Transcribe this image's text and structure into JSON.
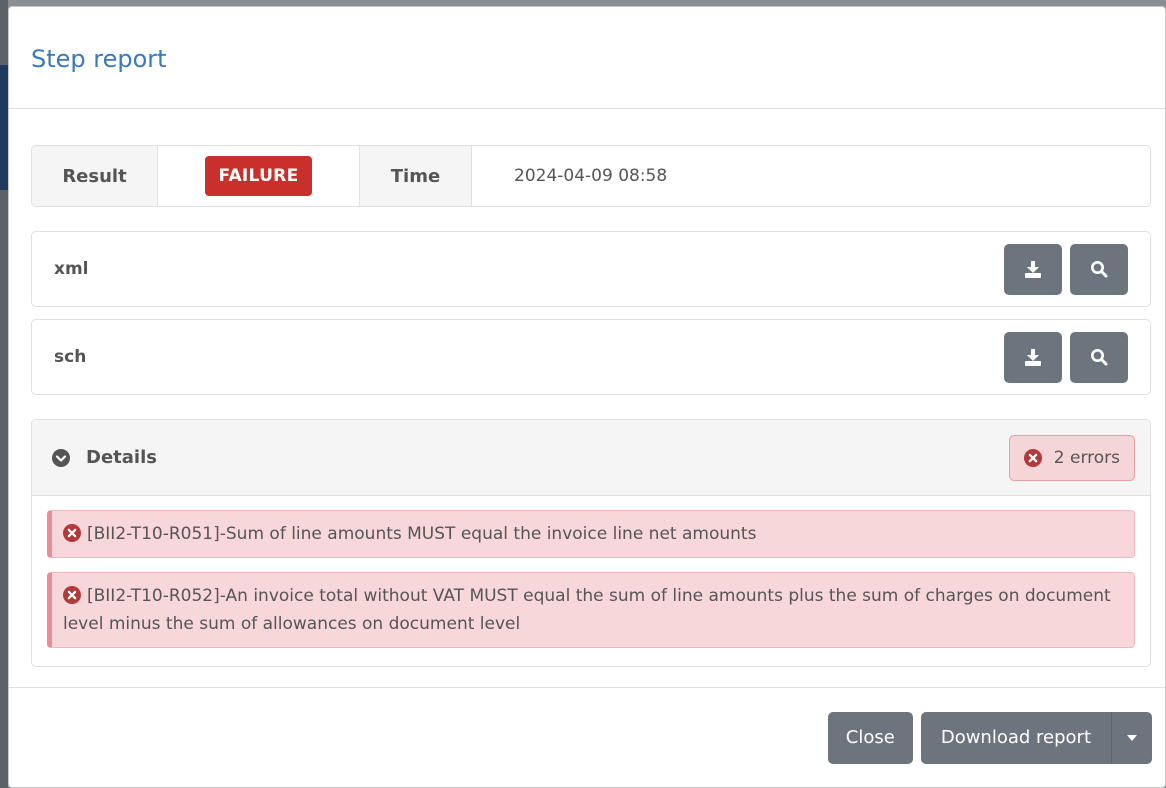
{
  "dialog": {
    "title": "Step report"
  },
  "summary": {
    "result_label": "Result",
    "result_value": "FAILURE",
    "time_label": "Time",
    "time_value": "2024-04-09 08:58",
    "colors": {
      "failure": "#c9302c"
    }
  },
  "files": [
    {
      "name": "xml",
      "download_icon": "download-icon",
      "view_icon": "search-icon"
    },
    {
      "name": "sch",
      "download_icon": "download-icon",
      "view_icon": "search-icon"
    }
  ],
  "details": {
    "title": "Details",
    "toggle_icon": "chevron-down-circle-icon",
    "error_count": "2 errors",
    "errors": [
      {
        "text": "[BII2-T10-R051]-Sum of line amounts MUST equal the invoice line net amounts"
      },
      {
        "text": "[BII2-T10-R052]-An invoice total without VAT MUST equal the sum of line amounts plus the sum of charges on document level minus the sum of allowances on document level"
      }
    ]
  },
  "footer": {
    "close_label": "Close",
    "download_label": "Download report"
  }
}
